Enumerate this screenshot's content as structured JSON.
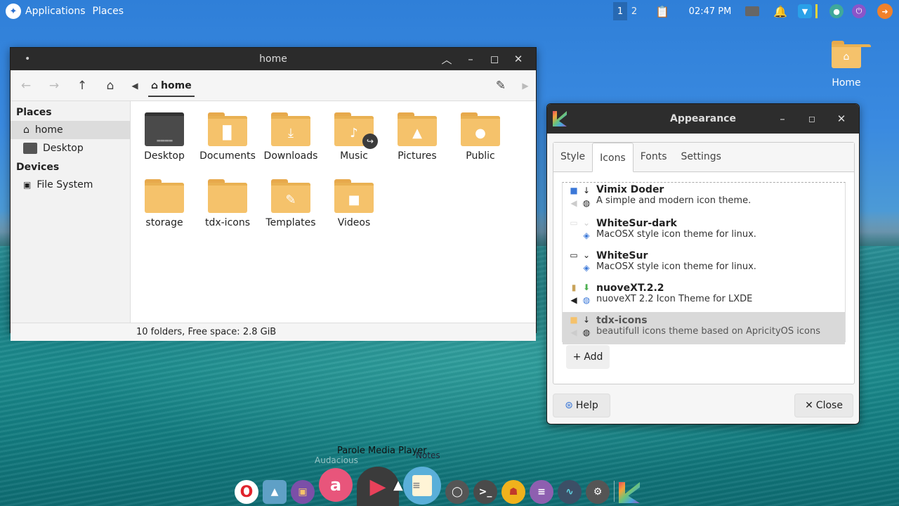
{
  "topbar": {
    "applications": "Applications",
    "places": "Places",
    "workspaces": [
      "1",
      "2"
    ],
    "clock": "02:47 PM"
  },
  "desktop_icon": {
    "label": "Home"
  },
  "file_manager": {
    "title": "home",
    "breadcrumb": "home",
    "sidebar": {
      "places_header": "Places",
      "places": [
        "home",
        "Desktop"
      ],
      "devices_header": "Devices",
      "devices": [
        "File System"
      ]
    },
    "items": [
      "Desktop",
      "Documents",
      "Downloads",
      "Music",
      "Pictures",
      "Public",
      "storage",
      "tdx-icons",
      "Templates",
      "Videos"
    ],
    "status": "10 folders, Free space: 2.8 GiB"
  },
  "appearance": {
    "title": "Appearance",
    "tabs": [
      "Style",
      "Icons",
      "Fonts",
      "Settings"
    ],
    "themes": [
      {
        "name": "Vimix Doder",
        "desc": "A simple and modern icon theme."
      },
      {
        "name": "WhiteSur-dark",
        "desc": "MacOSX style icon theme for linux."
      },
      {
        "name": "WhiteSur",
        "desc": "MacOSX style icon theme for linux."
      },
      {
        "name": "nuoveXT.2.2",
        "desc": "nuoveXT 2.2 Icon Theme for LXDE"
      },
      {
        "name": "tdx-icons",
        "desc": "beautifull icons theme based on ApricityOS icons"
      }
    ],
    "add_label": "Add",
    "help_label": "Help",
    "close_label": "Close"
  },
  "dock": {
    "tooltip": "Parole Media Player",
    "tooltip_ghost_left": "Audacious",
    "tooltip_ghost_right": "Notes"
  },
  "colors": {
    "folder": "#f5c26b",
    "titlebar": "#2b2b2b",
    "accent_orange": "#f0812a"
  }
}
